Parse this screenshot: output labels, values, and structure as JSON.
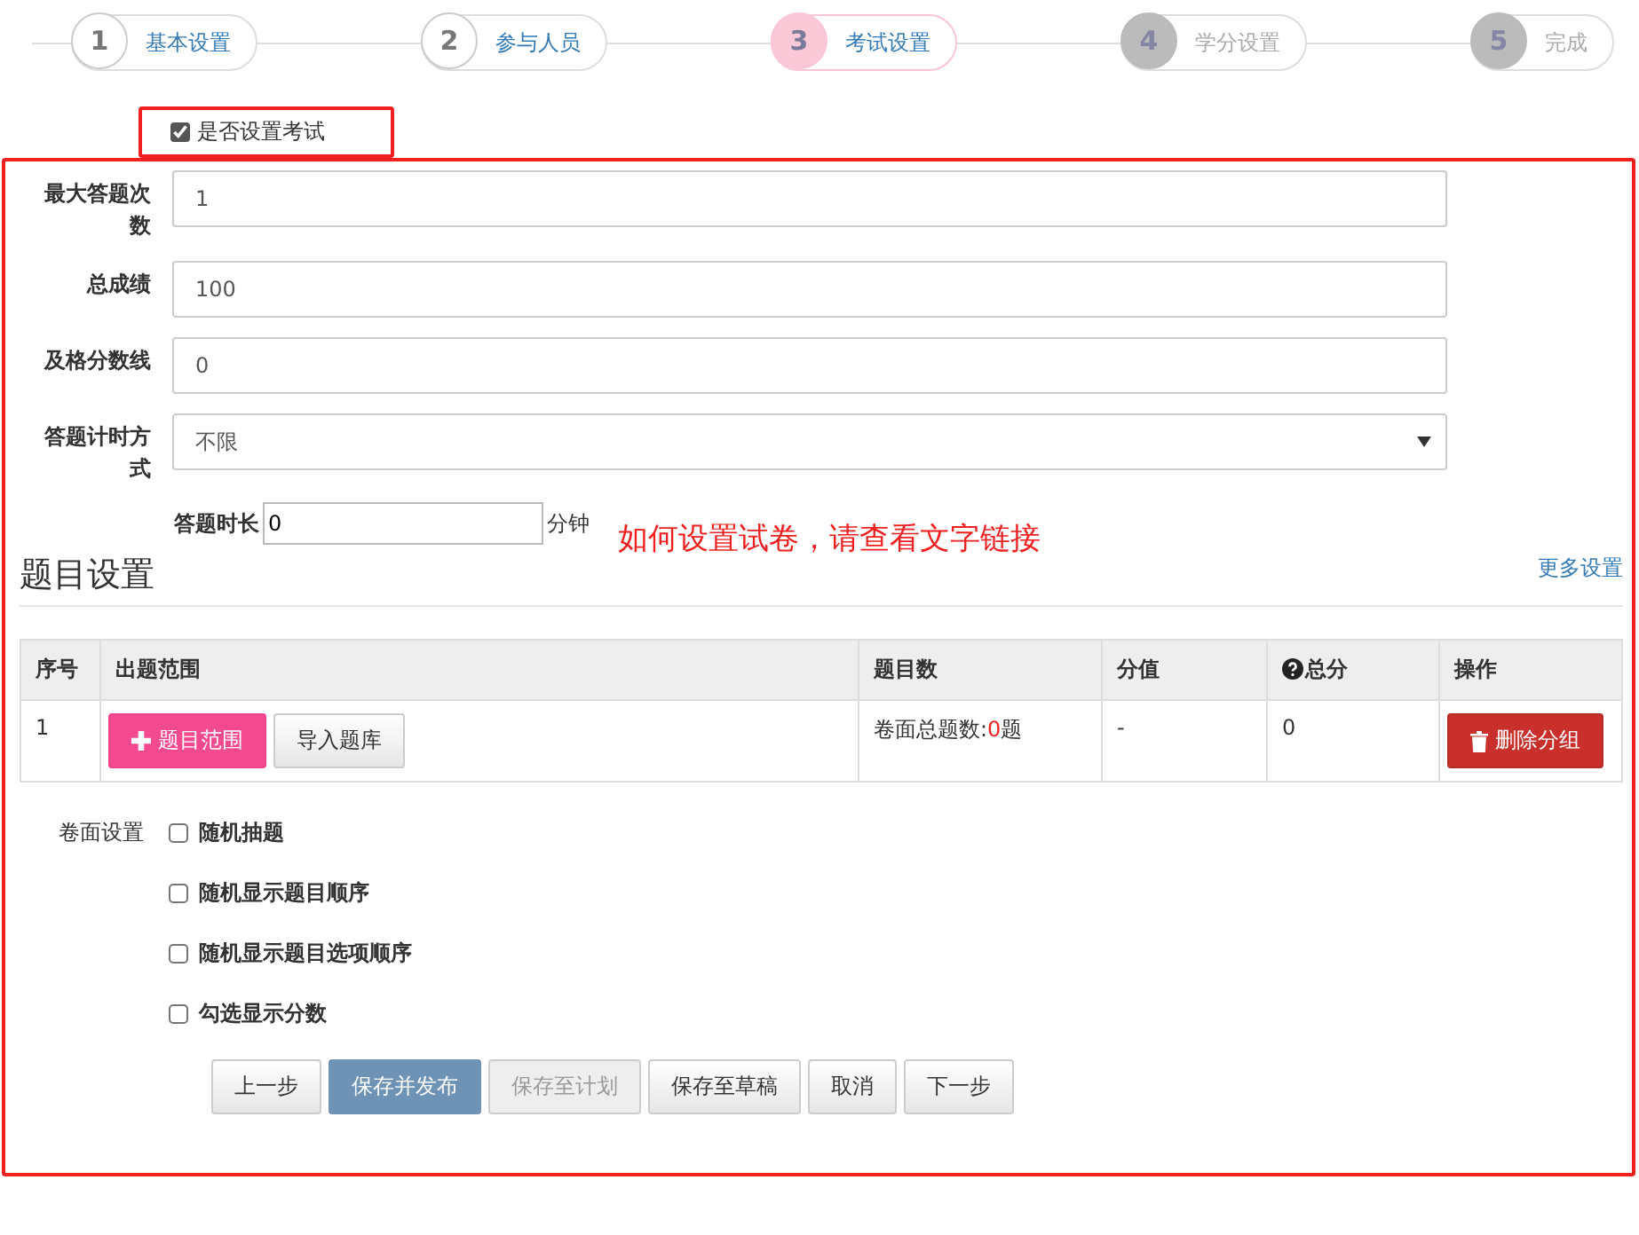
{
  "steps": [
    {
      "number": "1",
      "label": "基本设置",
      "selected": false,
      "reached": true
    },
    {
      "number": "2",
      "label": "参与人员",
      "selected": false,
      "reached": true
    },
    {
      "number": "3",
      "label": "考试设置",
      "selected": true,
      "reached": true
    },
    {
      "number": "4",
      "label": "学分设置",
      "selected": false,
      "reached": false
    },
    {
      "number": "5",
      "label": "完成",
      "selected": false,
      "reached": false
    }
  ],
  "exam_toggle": {
    "label": "是否设置考试",
    "checked": true
  },
  "fields": [
    {
      "label": "最大答题次数",
      "kind": "text",
      "value": "1"
    },
    {
      "label": "总成绩",
      "kind": "text",
      "value": "100"
    },
    {
      "label": "及格分数线",
      "kind": "text",
      "value": "0"
    },
    {
      "label": "答题计时方式",
      "kind": "select",
      "value": "不限"
    }
  ],
  "duration": {
    "label": "答题时长",
    "value": "0",
    "unit": "分钟"
  },
  "annotation": "如何设置试卷，请查看文字链接",
  "section": {
    "title": "题目设置",
    "link": "更多设置"
  },
  "table": {
    "columns": [
      "序号",
      "出题范围",
      "题目数",
      "分值",
      "总分",
      "操作"
    ],
    "rows": [
      {
        "index": "1",
        "range_button": "题目范围",
        "import_button": "导入题库",
        "count": {
          "prefix": "卷面总题数:",
          "value": "0",
          "suffix": "题"
        },
        "score": "-",
        "total": "0",
        "delete_button": "删除分组"
      }
    ]
  },
  "paper_settings": {
    "label": "卷面设置",
    "options": [
      {
        "label": "随机抽题",
        "checked": false
      },
      {
        "label": "随机显示题目顺序",
        "checked": false
      },
      {
        "label": "随机显示题目选项顺序",
        "checked": false
      },
      {
        "label": "勾选显示分数",
        "checked": false
      }
    ]
  },
  "buttons": [
    {
      "label": "上一步",
      "kind": "default"
    },
    {
      "label": "保存并发布",
      "kind": "primary"
    },
    {
      "label": "保存至计划",
      "kind": "disabled"
    },
    {
      "label": "保存至草稿",
      "kind": "default"
    },
    {
      "label": "取消",
      "kind": "default"
    },
    {
      "label": "下一步",
      "kind": "default"
    }
  ]
}
